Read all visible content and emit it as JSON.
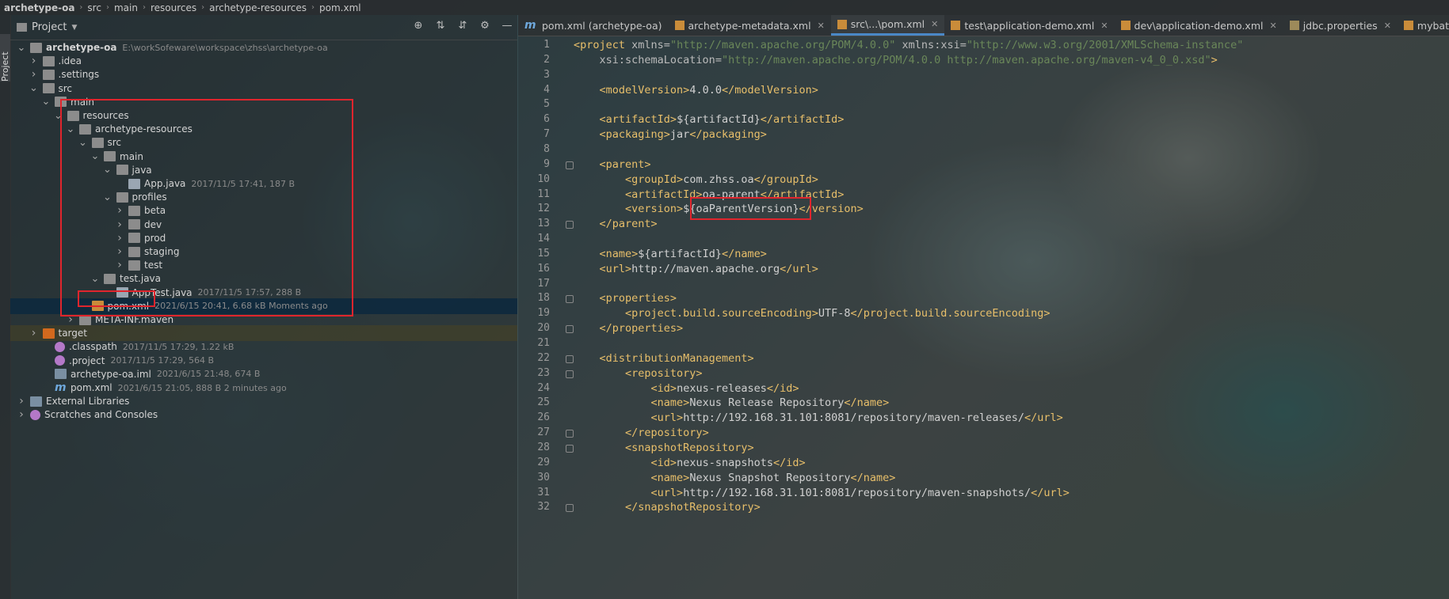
{
  "breadcrumb": [
    "archetype-oa",
    "src",
    "main",
    "resources",
    "archetype-resources",
    "pom.xml"
  ],
  "side_strip_label": "Project",
  "project_panel": {
    "title": "Project",
    "tree": [
      {
        "depth": 0,
        "arrow": "down",
        "icon": "module",
        "name": "archetype-oa",
        "meta": "E:\\workSofeware\\workspace\\zhss\\archetype-oa",
        "bold": true
      },
      {
        "depth": 1,
        "arrow": "right",
        "icon": "folder",
        "name": ".idea",
        "meta": ""
      },
      {
        "depth": 1,
        "arrow": "right",
        "icon": "folder",
        "name": ".settings",
        "meta": ""
      },
      {
        "depth": 1,
        "arrow": "down",
        "icon": "folder",
        "name": "src",
        "meta": ""
      },
      {
        "depth": 2,
        "arrow": "down",
        "icon": "folder",
        "name": "main",
        "meta": ""
      },
      {
        "depth": 3,
        "arrow": "down",
        "icon": "folder",
        "name": "resources",
        "meta": ""
      },
      {
        "depth": 4,
        "arrow": "down",
        "icon": "folder",
        "name": "archetype-resources",
        "meta": ""
      },
      {
        "depth": 5,
        "arrow": "down",
        "icon": "folder",
        "name": "src",
        "meta": ""
      },
      {
        "depth": 6,
        "arrow": "down",
        "icon": "folder",
        "name": "main",
        "meta": ""
      },
      {
        "depth": 7,
        "arrow": "down",
        "icon": "folder",
        "name": "java",
        "meta": ""
      },
      {
        "depth": 8,
        "arrow": "",
        "icon": "java",
        "name": "App.java",
        "meta": "2017/11/5 17:41, 187 B"
      },
      {
        "depth": 7,
        "arrow": "down",
        "icon": "folder",
        "name": "profiles",
        "meta": ""
      },
      {
        "depth": 8,
        "arrow": "right",
        "icon": "folder",
        "name": "beta",
        "meta": ""
      },
      {
        "depth": 8,
        "arrow": "right",
        "icon": "folder",
        "name": "dev",
        "meta": ""
      },
      {
        "depth": 8,
        "arrow": "right",
        "icon": "folder",
        "name": "prod",
        "meta": ""
      },
      {
        "depth": 8,
        "arrow": "right",
        "icon": "folder",
        "name": "staging",
        "meta": ""
      },
      {
        "depth": 8,
        "arrow": "right",
        "icon": "folder",
        "name": "test",
        "meta": ""
      },
      {
        "depth": 6,
        "arrow": "down",
        "icon": "folder",
        "name": "test.java",
        "meta": ""
      },
      {
        "depth": 7,
        "arrow": "",
        "icon": "java",
        "name": "AppTest.java",
        "meta": "2017/11/5 17:57, 288 B"
      },
      {
        "depth": 5,
        "arrow": "",
        "icon": "xml",
        "name": "pom.xml",
        "meta": "2021/6/15 20:41, 6.68 kB  Moments ago",
        "selected": true
      },
      {
        "depth": 4,
        "arrow": "right",
        "icon": "folder",
        "name": "META-INF.maven",
        "meta": ""
      },
      {
        "depth": 1,
        "arrow": "right",
        "icon": "folder-orange",
        "name": "target",
        "meta": "",
        "hl": true
      },
      {
        "depth": 2,
        "arrow": "",
        "icon": "cp",
        "name": ".classpath",
        "meta": "2017/11/5 17:29, 1.22 kB"
      },
      {
        "depth": 2,
        "arrow": "",
        "icon": "cp",
        "name": ".project",
        "meta": "2017/11/5 17:29, 564 B"
      },
      {
        "depth": 2,
        "arrow": "",
        "icon": "iml",
        "name": "archetype-oa.iml",
        "meta": "2021/6/15 21:48, 674 B"
      },
      {
        "depth": 2,
        "arrow": "",
        "icon": "maven",
        "name": "pom.xml",
        "meta": "2021/6/15 21:05, 888 B  2 minutes ago"
      },
      {
        "depth": 0,
        "arrow": "right",
        "icon": "libs",
        "name": "External Libraries",
        "meta": ""
      },
      {
        "depth": 0,
        "arrow": "right",
        "icon": "scratch",
        "name": "Scratches and Consoles",
        "meta": ""
      }
    ]
  },
  "editor_tabs": [
    {
      "label": "pom.xml (archetype-oa)",
      "icon": "maven",
      "active": false,
      "closable": false
    },
    {
      "label": "archetype-metadata.xml",
      "icon": "xml",
      "active": false,
      "closable": true
    },
    {
      "label": "src\\...\\pom.xml",
      "icon": "xml",
      "active": true,
      "closable": true
    },
    {
      "label": "test\\application-demo.xml",
      "icon": "xml",
      "active": false,
      "closable": true
    },
    {
      "label": "dev\\application-demo.xml",
      "icon": "xml",
      "active": false,
      "closable": true
    },
    {
      "label": "jdbc.properties",
      "icon": "props",
      "active": false,
      "closable": true
    },
    {
      "label": "mybatis-config",
      "icon": "xml",
      "active": false,
      "closable": false
    }
  ],
  "code_lines": [
    [
      [
        "tag",
        "<project "
      ],
      [
        "attr",
        "xmlns="
      ],
      [
        "str",
        "\"http://maven.apache.org/POM/4.0.0\""
      ],
      [
        "attr",
        " xmlns:xsi="
      ],
      [
        "str",
        "\"http://www.w3.org/2001/XMLSchema-instance\""
      ]
    ],
    [
      [
        "txt",
        "    "
      ],
      [
        "attr",
        "xsi:schemaLocation="
      ],
      [
        "str",
        "\"http://maven.apache.org/POM/4.0.0 http://maven.apache.org/maven-v4_0_0.xsd\""
      ],
      [
        "tag",
        ">"
      ]
    ],
    [],
    [
      [
        "txt",
        "    "
      ],
      [
        "tag",
        "<modelVersion>"
      ],
      [
        "txt",
        "4.0.0"
      ],
      [
        "tag",
        "</modelVersion>"
      ]
    ],
    [],
    [
      [
        "txt",
        "    "
      ],
      [
        "tag",
        "<artifactId>"
      ],
      [
        "txt",
        "${artifactId}"
      ],
      [
        "tag",
        "</artifactId>"
      ]
    ],
    [
      [
        "txt",
        "    "
      ],
      [
        "tag",
        "<packaging>"
      ],
      [
        "txt",
        "jar"
      ],
      [
        "tag",
        "</packaging>"
      ]
    ],
    [],
    [
      [
        "txt",
        "    "
      ],
      [
        "tag",
        "<parent>"
      ]
    ],
    [
      [
        "txt",
        "        "
      ],
      [
        "tag",
        "<groupId>"
      ],
      [
        "txt",
        "com.zhss.oa"
      ],
      [
        "tag",
        "</groupId>"
      ]
    ],
    [
      [
        "txt",
        "        "
      ],
      [
        "tag",
        "<artifactId>"
      ],
      [
        "txt",
        "oa-parent"
      ],
      [
        "tag",
        "</artifactId>"
      ]
    ],
    [
      [
        "txt",
        "        "
      ],
      [
        "tag",
        "<version>"
      ],
      [
        "txt",
        "${oaParentVersion}"
      ],
      [
        "tag",
        "</version>"
      ]
    ],
    [
      [
        "txt",
        "    "
      ],
      [
        "tag",
        "</parent>"
      ]
    ],
    [],
    [
      [
        "txt",
        "    "
      ],
      [
        "tag",
        "<name>"
      ],
      [
        "txt",
        "${artifactId}"
      ],
      [
        "tag",
        "</name>"
      ]
    ],
    [
      [
        "txt",
        "    "
      ],
      [
        "tag",
        "<url>"
      ],
      [
        "txt",
        "http://maven.apache.org"
      ],
      [
        "tag",
        "</url>"
      ]
    ],
    [],
    [
      [
        "txt",
        "    "
      ],
      [
        "tag",
        "<properties>"
      ]
    ],
    [
      [
        "txt",
        "        "
      ],
      [
        "tag",
        "<project.build.sourceEncoding>"
      ],
      [
        "txt",
        "UTF-8"
      ],
      [
        "tag",
        "</project.build.sourceEncoding>"
      ]
    ],
    [
      [
        "txt",
        "    "
      ],
      [
        "tag",
        "</properties>"
      ]
    ],
    [],
    [
      [
        "txt",
        "    "
      ],
      [
        "tag",
        "<distributionManagement>"
      ]
    ],
    [
      [
        "txt",
        "        "
      ],
      [
        "tag",
        "<repository>"
      ]
    ],
    [
      [
        "txt",
        "            "
      ],
      [
        "tag",
        "<id>"
      ],
      [
        "txt",
        "nexus-releases"
      ],
      [
        "tag",
        "</id>"
      ]
    ],
    [
      [
        "txt",
        "            "
      ],
      [
        "tag",
        "<name>"
      ],
      [
        "txt",
        "Nexus Release Repository"
      ],
      [
        "tag",
        "</name>"
      ]
    ],
    [
      [
        "txt",
        "            "
      ],
      [
        "tag",
        "<url>"
      ],
      [
        "txt",
        "http://192.168.31.101:8081/repository/maven-releases/"
      ],
      [
        "tag",
        "</url>"
      ]
    ],
    [
      [
        "txt",
        "        "
      ],
      [
        "tag",
        "</repository>"
      ]
    ],
    [
      [
        "txt",
        "        "
      ],
      [
        "tag",
        "<snapshotRepository>"
      ]
    ],
    [
      [
        "txt",
        "            "
      ],
      [
        "tag",
        "<id>"
      ],
      [
        "txt",
        "nexus-snapshots"
      ],
      [
        "tag",
        "</id>"
      ]
    ],
    [
      [
        "txt",
        "            "
      ],
      [
        "tag",
        "<name>"
      ],
      [
        "txt",
        "Nexus Snapshot Repository"
      ],
      [
        "tag",
        "</name>"
      ]
    ],
    [
      [
        "txt",
        "            "
      ],
      [
        "tag",
        "<url>"
      ],
      [
        "txt",
        "http://192.168.31.101:8081/repository/maven-snapshots/"
      ],
      [
        "tag",
        "</url>"
      ]
    ],
    [
      [
        "txt",
        "        "
      ],
      [
        "tag",
        "</snapshotRepository>"
      ]
    ]
  ],
  "colors": {
    "tag": "#e8bf6a",
    "string": "#6a8759",
    "annotation": "#e0252d",
    "selection": "#0d293e",
    "active_tab": "#4a88c7"
  }
}
